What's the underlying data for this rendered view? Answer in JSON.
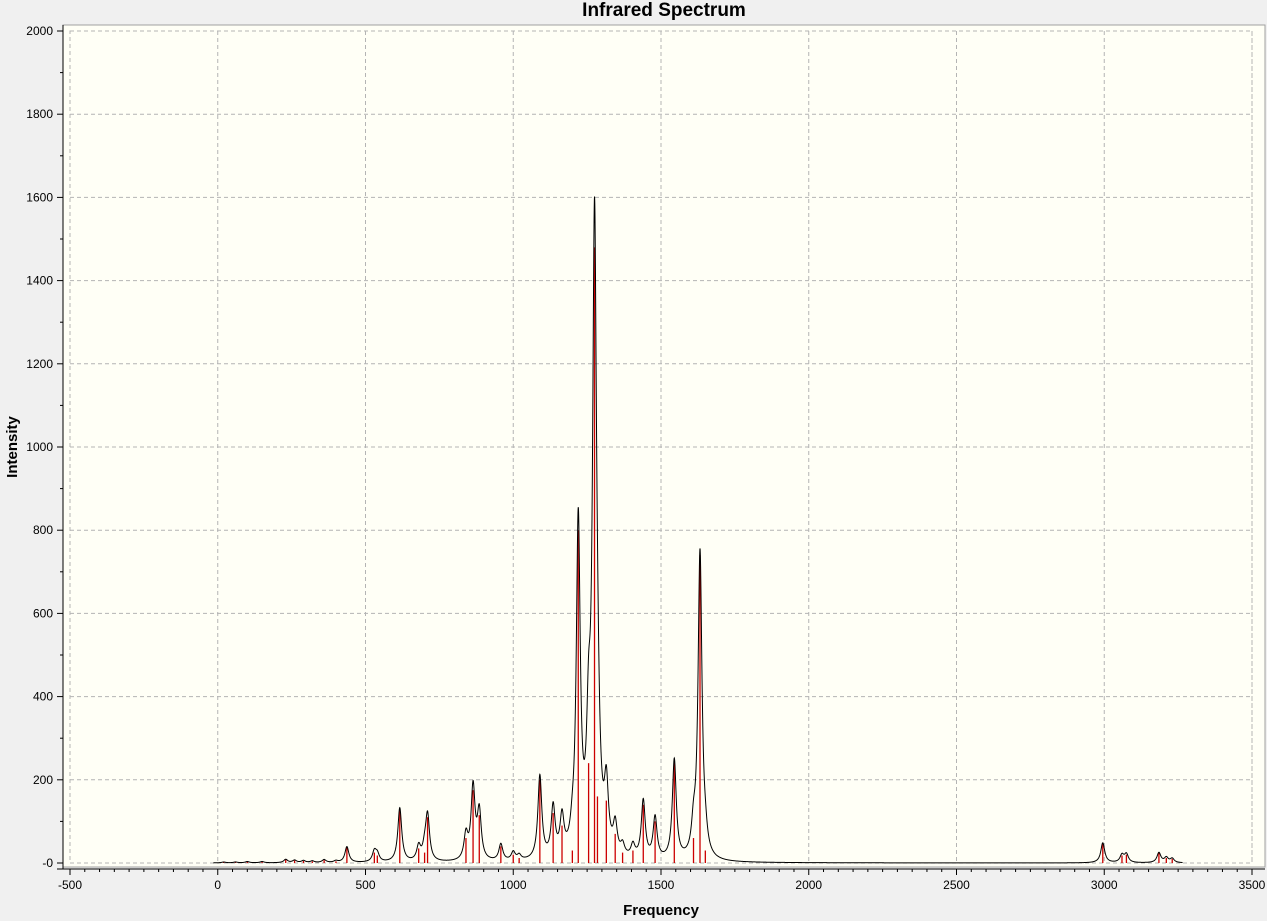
{
  "chart_data": {
    "type": "line",
    "title": "Infrared Spectrum",
    "xlabel": "Frequency",
    "ylabel": "Intensity",
    "xlim": [
      -500,
      3500
    ],
    "ylim": [
      0,
      2000
    ],
    "x_ticks": [
      -500,
      0,
      500,
      1000,
      1500,
      2000,
      2500,
      3000,
      3500
    ],
    "x_tick_labels": [
      "-500",
      "0",
      "500",
      "1000",
      "1500",
      "2000",
      "2500",
      "3000",
      "3500"
    ],
    "y_ticks": [
      0,
      200,
      400,
      600,
      800,
      1000,
      1200,
      1400,
      1600,
      1800,
      2000
    ],
    "y_tick_labels": [
      "-0",
      "200",
      "400",
      "600",
      "800",
      "1000",
      "1200",
      "1400",
      "1600",
      "1800",
      "2000"
    ],
    "grid": true,
    "colors": {
      "plot_background": "#fffff6",
      "spectrum_line": "#000000",
      "stick_lines": "#cc0000",
      "grid": "#b4b4b4"
    },
    "spectrum_range": [
      -15,
      3265
    ],
    "peak_halfwidth": 8,
    "sticks": [
      {
        "x": 20,
        "y": 2
      },
      {
        "x": 60,
        "y": 2
      },
      {
        "x": 100,
        "y": 3
      },
      {
        "x": 150,
        "y": 3
      },
      {
        "x": 230,
        "y": 8
      },
      {
        "x": 260,
        "y": 6
      },
      {
        "x": 290,
        "y": 5
      },
      {
        "x": 320,
        "y": 4
      },
      {
        "x": 360,
        "y": 7
      },
      {
        "x": 400,
        "y": 4
      },
      {
        "x": 437,
        "y": 38
      },
      {
        "x": 530,
        "y": 25
      },
      {
        "x": 540,
        "y": 18
      },
      {
        "x": 616,
        "y": 130
      },
      {
        "x": 680,
        "y": 35
      },
      {
        "x": 700,
        "y": 25
      },
      {
        "x": 710,
        "y": 110
      },
      {
        "x": 840,
        "y": 60
      },
      {
        "x": 864,
        "y": 175
      },
      {
        "x": 885,
        "y": 115
      },
      {
        "x": 958,
        "y": 40
      },
      {
        "x": 1000,
        "y": 20
      },
      {
        "x": 1020,
        "y": 12
      },
      {
        "x": 1090,
        "y": 200
      },
      {
        "x": 1135,
        "y": 120
      },
      {
        "x": 1165,
        "y": 90
      },
      {
        "x": 1200,
        "y": 30
      },
      {
        "x": 1220,
        "y": 800
      },
      {
        "x": 1255,
        "y": 240
      },
      {
        "x": 1275,
        "y": 1480
      },
      {
        "x": 1285,
        "y": 160
      },
      {
        "x": 1315,
        "y": 150
      },
      {
        "x": 1345,
        "y": 70
      },
      {
        "x": 1370,
        "y": 25
      },
      {
        "x": 1405,
        "y": 30
      },
      {
        "x": 1440,
        "y": 140
      },
      {
        "x": 1480,
        "y": 100
      },
      {
        "x": 1545,
        "y": 240
      },
      {
        "x": 1610,
        "y": 60
      },
      {
        "x": 1632,
        "y": 740
      },
      {
        "x": 1650,
        "y": 30
      },
      {
        "x": 2995,
        "y": 48
      },
      {
        "x": 3060,
        "y": 18
      },
      {
        "x": 3075,
        "y": 20
      },
      {
        "x": 3185,
        "y": 24
      },
      {
        "x": 3210,
        "y": 12
      },
      {
        "x": 3230,
        "y": 10
      }
    ]
  }
}
